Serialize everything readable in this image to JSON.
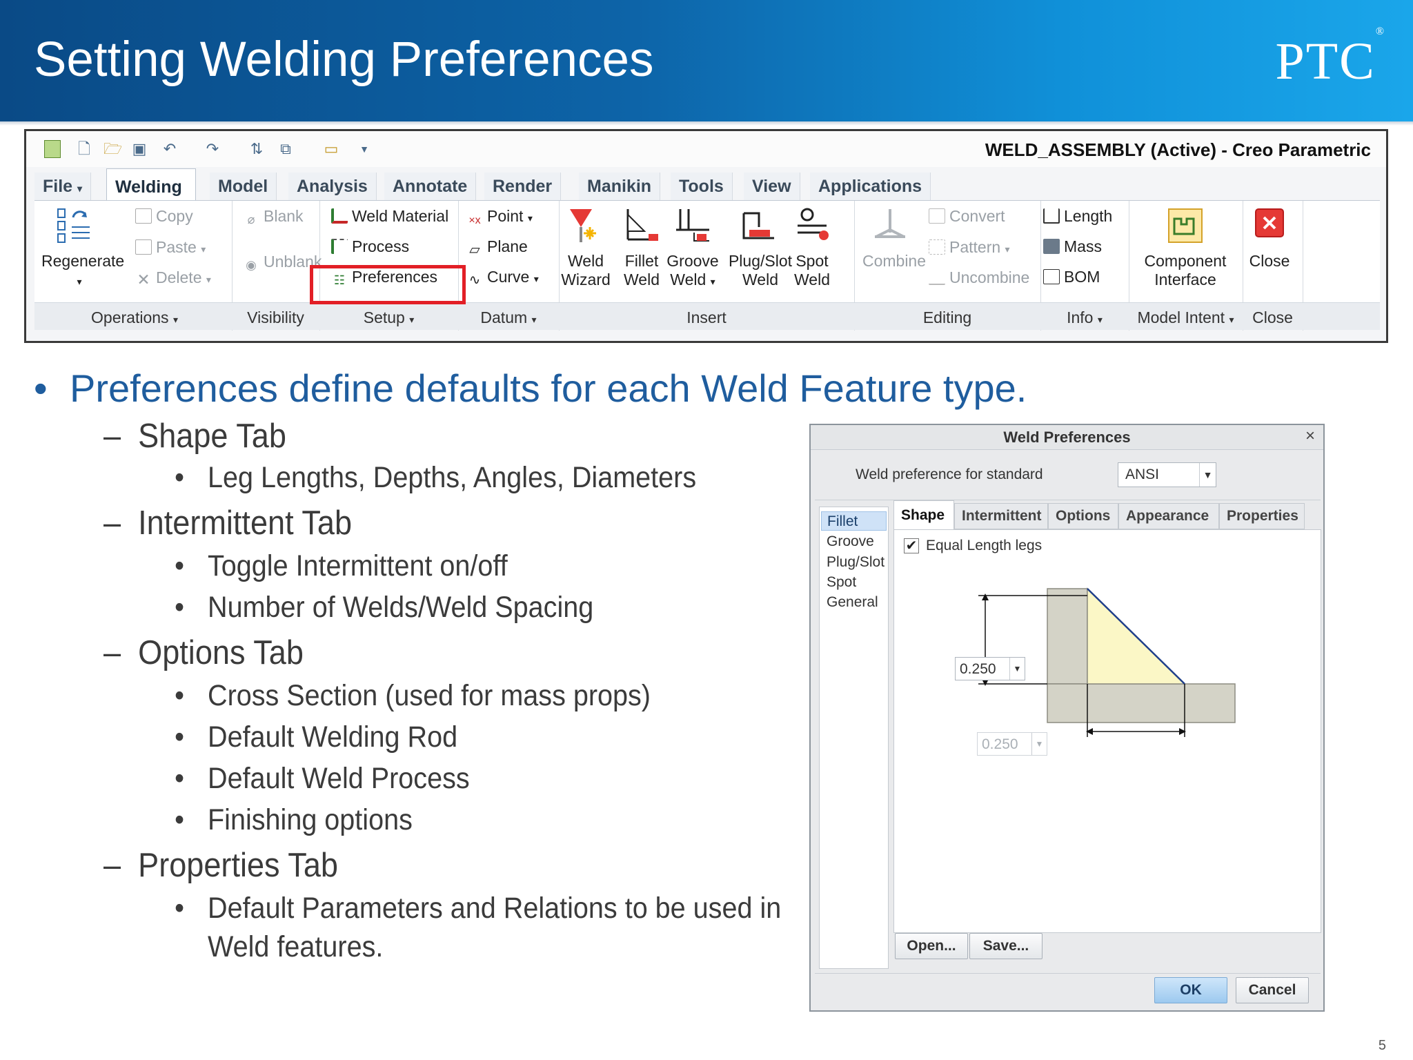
{
  "header": {
    "title": "Setting Welding Preferences",
    "logo": "PTC",
    "logo_mark": "®"
  },
  "ribbon": {
    "window_title": "WELD_ASSEMBLY (Active) - Creo Parametric",
    "tabs": [
      "File",
      "Welding",
      "Model",
      "Analysis",
      "Annotate",
      "Render",
      "Manikin",
      "Tools",
      "View",
      "Applications"
    ],
    "active_tab": "Welding",
    "operations": {
      "regenerate": "Regenerate",
      "copy": "Copy",
      "paste": "Paste",
      "delete": "Delete",
      "group": "Operations"
    },
    "visibility": {
      "blank": "Blank",
      "unblank": "Unblank",
      "group": "Visibility"
    },
    "setup": {
      "weld_material": "Weld Material",
      "process": "Process",
      "preferences": "Preferences",
      "group": "Setup"
    },
    "datum": {
      "point": "Point",
      "plane": "Plane",
      "curve": "Curve",
      "group": "Datum"
    },
    "insert": {
      "weld_wizard_1": "Weld",
      "weld_wizard_2": "Wizard",
      "fillet_weld_1": "Fillet",
      "fillet_weld_2": "Weld",
      "groove_weld_1": "Groove",
      "groove_weld_2": "Weld",
      "plug_slot_weld_1": "Plug/Slot",
      "plug_slot_weld_2": "Weld",
      "spot_weld_1": "Spot",
      "spot_weld_2": "Weld",
      "group": "Insert"
    },
    "editing": {
      "combine": "Combine",
      "convert": "Convert",
      "pattern": "Pattern",
      "uncombine": "Uncombine",
      "group": "Editing"
    },
    "info": {
      "length": "Length",
      "mass": "Mass",
      "bom": "BOM",
      "group": "Info"
    },
    "model_intent": {
      "component_interface_1": "Component",
      "component_interface_2": "Interface",
      "group": "Model Intent"
    },
    "close": {
      "close": "Close",
      "group": "Close"
    },
    "dropdown_arrow": "▾"
  },
  "bullets": {
    "main": "Preferences define defaults for each Weld Feature type.",
    "shape_tab": "Shape Tab",
    "shape_1": "Leg Lengths, Depths, Angles, Diameters",
    "intermittent_tab": "Intermittent Tab",
    "intermittent_1": "Toggle Intermittent on/off",
    "intermittent_2": "Number of Welds/Weld Spacing",
    "options_tab": "Options Tab",
    "options_1": "Cross Section (used for mass props)",
    "options_2": "Default Welding Rod",
    "options_3": "Default Weld Process",
    "options_4": "Finishing options",
    "properties_tab": "Properties Tab",
    "properties_1a": "Default Parameters and Relations to be used in",
    "properties_1b": "Weld features.",
    "dash": "–",
    "dot": "•"
  },
  "dialog": {
    "title": "Weld Preferences",
    "close": "×",
    "standard_label": "Weld preference for standard",
    "standard_value": "ANSI",
    "weld_types": [
      "Fillet",
      "Groove",
      "Plug/Slot",
      "Spot",
      "General"
    ],
    "selected_type": "Fillet",
    "tabs": [
      "Shape",
      "Intermittent",
      "Options",
      "Appearance",
      "Properties"
    ],
    "active_tab": "Shape",
    "equal_legs_label": "Equal Length legs",
    "equal_legs_checked": true,
    "check_mark": "✔",
    "leg_1": "0.250",
    "leg_2": "0.250",
    "open_button": "Open...",
    "save_button": "Save...",
    "ok_button": "OK",
    "cancel_button": "Cancel"
  },
  "page_number": "5"
}
